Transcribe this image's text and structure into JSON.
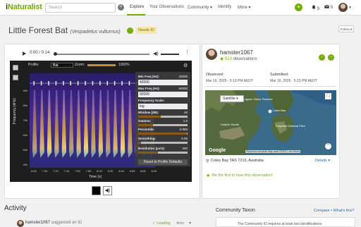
{
  "header": {
    "logo_prefix": "i",
    "logo_suffix": "Naturalist",
    "search_placeholder": "Search",
    "nav": [
      "Explore",
      "Your Observations",
      "Community ▾",
      "Identify",
      "More ▾"
    ],
    "user_initial": "•",
    "notifications": "0",
    "messages": "0"
  },
  "observation": {
    "common_name": "Little Forest Bat",
    "scientific_name": "(Vespadelus vulturnus)",
    "quality_grade": "Needs ID",
    "follow_label": "Follow ▾"
  },
  "audio": {
    "time": "0:00 / 0:14",
    "volume_icon": "speaker-icon",
    "menu_icon": "more-vertical-icon"
  },
  "spectrogram": {
    "profile_label": "Profile:",
    "profile_value": "Bat",
    "zoom_label": "Zoom:",
    "zoom_value": "1000%",
    "y_axis_label": "Frequency (kHz)",
    "x_axis_label": "Time (s)",
    "y_ticks": [
      "90k",
      "80k",
      "70k",
      "60k",
      "50k",
      "40k"
    ],
    "x_ticks": [
      "8.60",
      "7.00",
      "7.20",
      "7.40",
      "7.60",
      "7.80",
      "8.00",
      "8.20",
      "8.40",
      "8.60",
      "8.80",
      "8.00"
    ],
    "settings": {
      "min_freq_label": "Min Freq (Hz):",
      "min_freq_value": "42000",
      "min_freq_input": "42000",
      "max_freq_label": "Max Freq (Hz):",
      "max_freq_value": "93000",
      "max_freq_input": "92000",
      "scale_label": "Frequency Scale:",
      "scale_value": "log",
      "window_label": "Window (dB):",
      "window_value": "45",
      "gamma_label": "Gamma:",
      "gamma_value": "1.6",
      "percentile_label": "Percentile:",
      "percentile_value": "0.985",
      "smoothing_label": "Smoothing:",
      "smoothing_value": "0.05",
      "resolution_label": "Resolution (px/s):",
      "resolution_value": "400",
      "reset_label": "Reset to Profile Defaults",
      "slider_levels": {
        "window": 0.45,
        "gamma": 0.3,
        "percentile": 0.98,
        "smoothing": 0.05,
        "resolution": 0.4
      }
    }
  },
  "observer": {
    "name": "hamster1067",
    "obs_count": "510",
    "obs_suffix": " observations",
    "observed_label": "Observed:",
    "observed_value": "Mar 16, 2025 · 5:13 PM AEDT",
    "submitted_label": "Submitted:",
    "submitted_value": "Mar 16, 2025 · 5:15 PM AEDT"
  },
  "map": {
    "type_label": "Satellite ▾",
    "google": "Google",
    "attribution": "Keyboard shortcuts  Map data ©2025  1 km   Terms",
    "place_labels": [
      "Moulting Lagoon Game Reserve",
      "Coles Bay",
      "Freycinet National Park",
      "Dolphin Sands"
    ]
  },
  "location": {
    "text": "Coles Bay TAS 7215, Australia",
    "details_label": "Details ▾"
  },
  "fave": {
    "text": "Be the first to fave this observation!"
  },
  "activity": {
    "heading": "Activity",
    "user": "hamster1067",
    "action": " suggested an ID",
    "leading_label": "✓ Leading",
    "ago": "4mo",
    "community_heading": "Community Taxon",
    "compare_label": "Compare • What's this?",
    "community_text": "The Community ID requires at least two identifications"
  },
  "colors": {
    "brand_green": "#74ac00",
    "link_blue": "#2c6fa6",
    "badge_yellow": "#f7e9a5"
  }
}
